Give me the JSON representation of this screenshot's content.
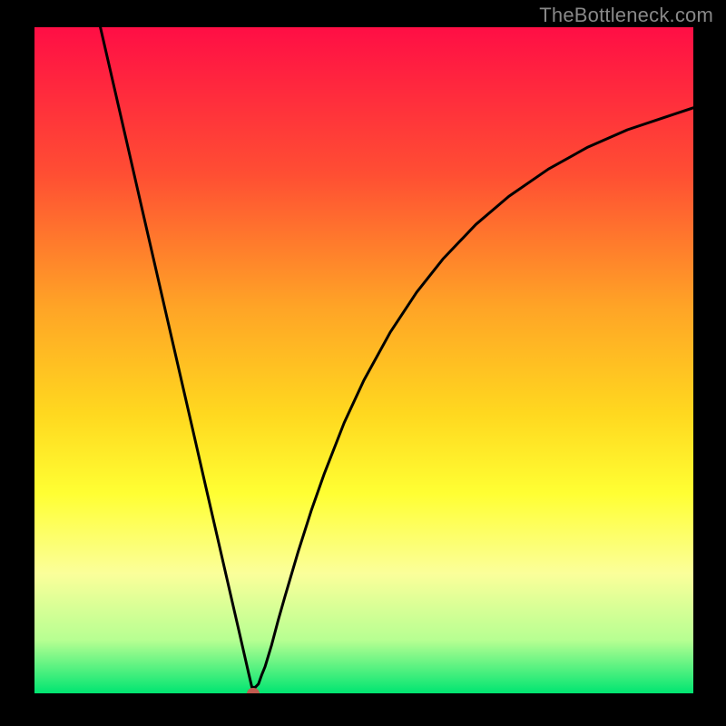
{
  "watermark_text": "TheBottleneck.com",
  "chart_data": {
    "type": "line",
    "title": "",
    "xlabel": "",
    "ylabel": "",
    "xlim": [
      0,
      100
    ],
    "ylim": [
      0,
      100
    ],
    "grid": false,
    "legend": false,
    "background_gradient": {
      "stops": [
        {
          "offset": 0,
          "color": "#FF0E45"
        },
        {
          "offset": 22,
          "color": "#FF4E33"
        },
        {
          "offset": 42,
          "color": "#FFA426"
        },
        {
          "offset": 58,
          "color": "#FFD81F"
        },
        {
          "offset": 70,
          "color": "#FFFF33"
        },
        {
          "offset": 82,
          "color": "#FBFF9A"
        },
        {
          "offset": 92,
          "color": "#B7FF92"
        },
        {
          "offset": 100,
          "color": "#00E571"
        }
      ]
    },
    "marker": {
      "x": 33.2,
      "y": 0,
      "color": "#C25A4F",
      "r": 7
    },
    "series": [
      {
        "name": "curve",
        "x": [
          10,
          12,
          14,
          16,
          18,
          20,
          22,
          24,
          26,
          28,
          30,
          31,
          32,
          32.5,
          33,
          33.5,
          34,
          34.5,
          35,
          36,
          37,
          38,
          40,
          42,
          44,
          47,
          50,
          54,
          58,
          62,
          67,
          72,
          78,
          84,
          90,
          96,
          100
        ],
        "y": [
          100,
          91.4,
          82.8,
          74.1,
          65.5,
          56.9,
          48.3,
          39.7,
          31.0,
          22.4,
          13.8,
          9.5,
          5.2,
          3.0,
          0.9,
          0.9,
          1.4,
          2.8,
          4.0,
          7.3,
          11.0,
          14.5,
          21.2,
          27.4,
          33.0,
          40.6,
          47.0,
          54.2,
          60.2,
          65.2,
          70.4,
          74.6,
          78.7,
          82.0,
          84.6,
          86.6,
          87.9
        ]
      }
    ]
  }
}
